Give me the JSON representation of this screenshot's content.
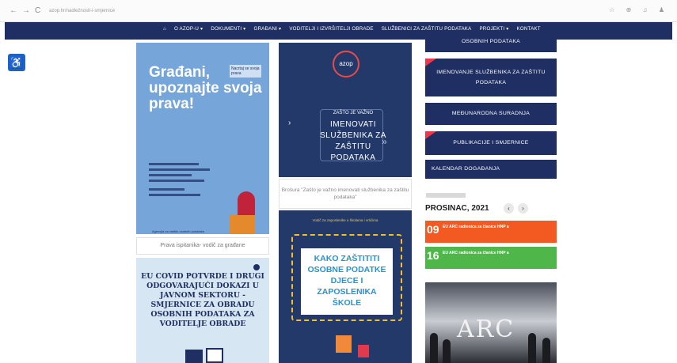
{
  "browser": {
    "back": "←",
    "forward": "→",
    "reload": "C",
    "url": "azop.hr/nadležnosti-i-smjernice",
    "right_icons": "☆ ⊕ ♫ ♟"
  },
  "menu": {
    "home_icon": "home-icon",
    "items": [
      "O AZOP-U ▾",
      "DOKUMENTI ▾",
      "GRAĐANI ▾",
      "VODITELJI I IZVRŠITELJI OBRADE",
      "SLUŽBENICI ZA ZAŠTITU PODATAKA",
      "PROJEKTI ▾",
      "KONTAKT"
    ]
  },
  "accessibility": {
    "icon": "accessibility-icon",
    "glyph": "♿"
  },
  "left_column": {
    "card1_title": "Građani, upoznajte svoja prava!",
    "card1_tag": "Nacrtaj se svoja prava",
    "card1_logo": "az●p",
    "card1_footer": "Agencija za zaštitu osobnih podataka",
    "card1_caption": "Prava ispitanika- vodič za građane",
    "card2_title": "EU COVID POTVRDE I DRUGI ODGOVARAJUĆI DOKAZI U JAVNOM SEKTORU - SMJERNICE ZA OBRADU OSOBNIH PODATAKA ZA VODITELJE OBRADE"
  },
  "middle_column": {
    "card3_logo": "azop",
    "card3_line1": "ZAŠTO JE VAŽNO",
    "card3_line2": "IMENOVATI SLUŽBENIKA ZA ZAŠTITU PODATAKA",
    "card3_caption": "Brošura \"Zašto je važno imenovati službenika za zaštitu podataka\"",
    "card4_header": "Vodič za zaposlenike u školama i vrtićima",
    "card4_title": "KAKO ZAŠTITITI OSOBNE PODATKE DJECE I ZAPOSLENIKA ŠKOLE"
  },
  "right_column": {
    "buttons": [
      "OSOBNIH PODATAKA",
      "IMENOVANJE SLUŽBENIKA ZA ZAŠTITU PODATAKA",
      "MEĐUNARODNA SURADNJA",
      "PUBLIKACIJE I SMJERNICE",
      "KALENDAR DOGAĐANJA"
    ],
    "calendar": {
      "month": "PROSINAC, 2021",
      "prev": "‹",
      "next": "›",
      "events": [
        {
          "day": "09",
          "title": "EU ARC radionica za članice HNP a",
          "color": "#f25a22"
        },
        {
          "day": "16",
          "title": "EU ARC radionica za članice HNP a",
          "color": "#4fb64a"
        }
      ]
    },
    "photo_text": "ARC"
  },
  "colors": {
    "navy": "#1f2f63",
    "red": "#e63a4a",
    "orange": "#f25a22",
    "green": "#4fb64a"
  }
}
